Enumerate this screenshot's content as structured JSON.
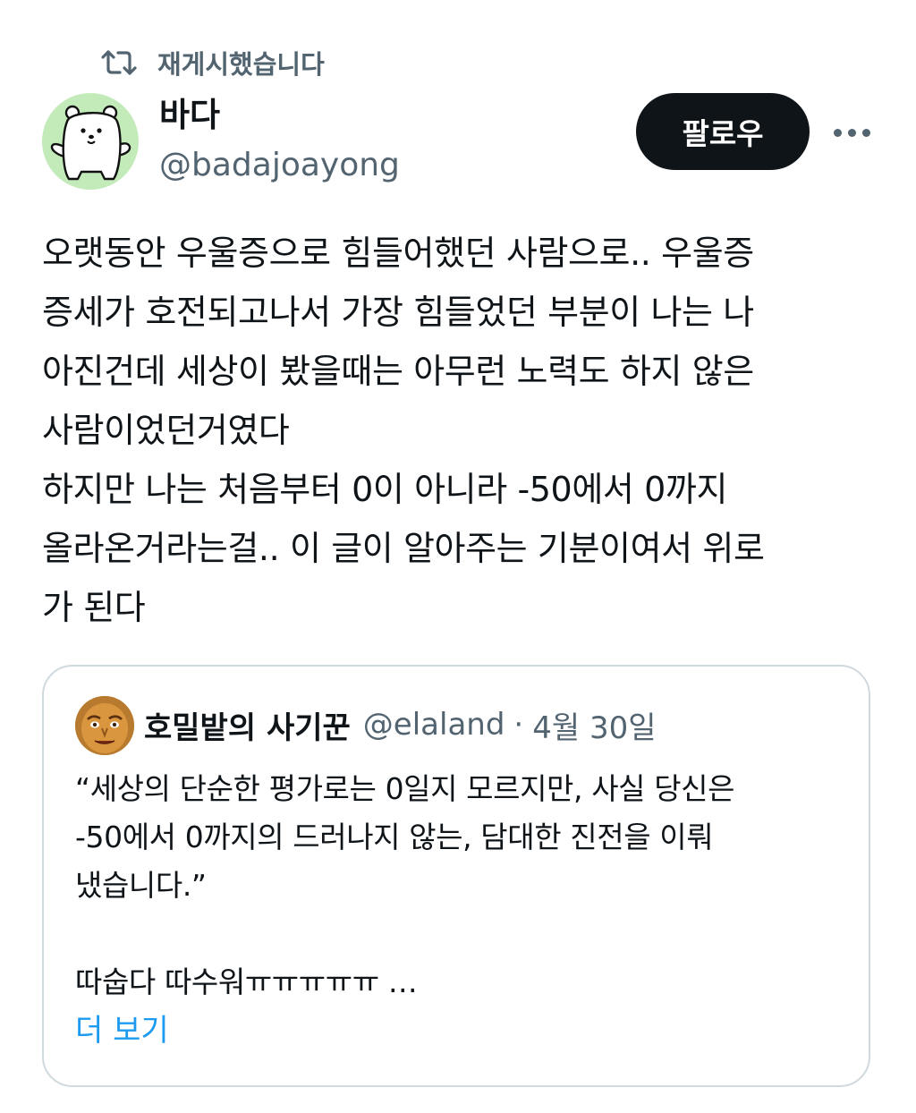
{
  "repost": {
    "icon": "repost-icon",
    "label": "재게시했습니다"
  },
  "author": {
    "name": "바다",
    "handle": "@badajoayong",
    "avatar_bg": "#c3ebba"
  },
  "actions": {
    "follow_label": "팔로우",
    "more_icon": "more-icon"
  },
  "tweet": {
    "text": "오랫동안 우울증으로 힘들어했던 사람으로.. 우울증\n증세가 호전되고나서 가장 힘들었던 부분이 나는 나\n아진건데 세상이 봤을때는 아무런 노력도 하지 않은\n사람이었던거였다\n하지만 나는 처음부터 0이 아니라 -50에서 0까지\n올라온거라는걸.. 이 글이 알아주는 기분이여서 위로\n가 된다"
  },
  "quote": {
    "name": "호밀밭의 사기꾼",
    "handle": "@elaland",
    "separator": "·",
    "date": "4월 30일",
    "text": "“세상의 단순한 평가로는 0일지 모르지만, 사실 당신은\n-50에서 0까지의 드러나지 않는, 담대한 진전을 이뤄\n냈습니다.”\n\n따숩다 따수워ㅠㅠㅠㅠㅠ …",
    "more_label": "더 보기"
  },
  "colors": {
    "text": "#0f1419",
    "secondary": "#536471",
    "link": "#1d9bf0",
    "border": "#cfd9de",
    "button": "#0f1419"
  }
}
